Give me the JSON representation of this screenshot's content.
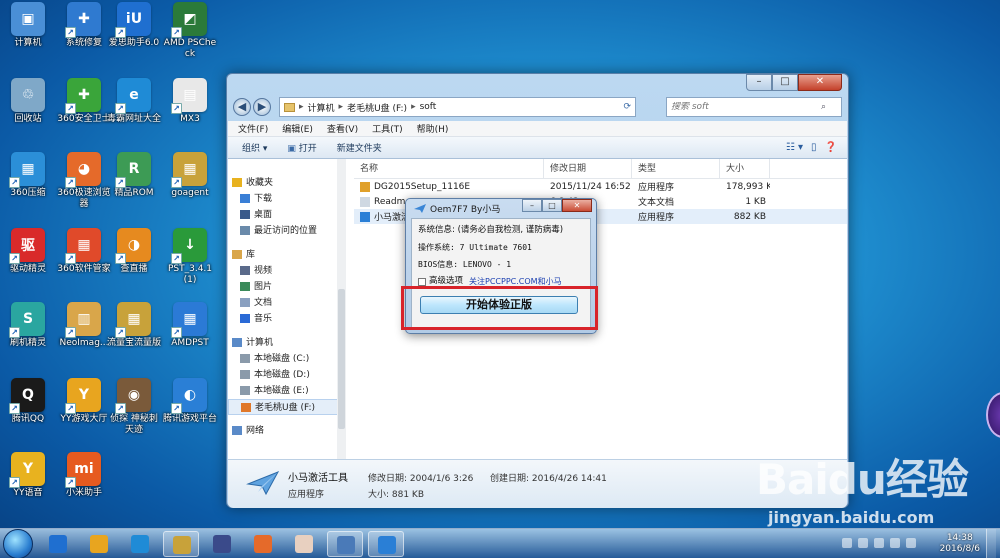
{
  "desktop": {
    "icons": [
      {
        "label": "计算机",
        "color": "#4a8fd6",
        "glyph": "▣"
      },
      {
        "label": "系统修复",
        "color": "#2f7ad0",
        "glyph": "✚"
      },
      {
        "label": "爱思助手6.0",
        "color": "#1f6fd0",
        "glyph": "iU"
      },
      {
        "label": "AMD PSCheck",
        "color": "#2b7a3a",
        "glyph": "◩"
      },
      {
        "label": "回收站",
        "color": "#7fa8c8",
        "glyph": "♲"
      },
      {
        "label": "360安全卫士",
        "color": "#3aa53a",
        "glyph": "✚"
      },
      {
        "label": "毒霸网址大全",
        "color": "#1f8bd6",
        "glyph": "e"
      },
      {
        "label": "MX3",
        "color": "#e8e8e8",
        "glyph": "▤"
      },
      {
        "label": "360压缩",
        "color": "#2b8fd8",
        "glyph": "▦"
      },
      {
        "label": "360极速浏览器",
        "color": "#e56a2a",
        "glyph": "◕"
      },
      {
        "label": "精品ROM",
        "color": "#3d9b55",
        "glyph": "R"
      },
      {
        "label": "goagent",
        "color": "#c8a23a",
        "glyph": "▦"
      },
      {
        "label": "驱动精灵",
        "color": "#d92a2a",
        "glyph": "驱"
      },
      {
        "label": "360软件管家",
        "color": "#e04a2a",
        "glyph": "▦"
      },
      {
        "label": "查直播",
        "color": "#e68a1f",
        "glyph": "◑"
      },
      {
        "label": "PST_3.4.1 (1)",
        "color": "#2a9a3a",
        "glyph": "↓"
      },
      {
        "label": "刷机精灵",
        "color": "#2aa6a0",
        "glyph": "S"
      },
      {
        "label": "NeoImag...",
        "color": "#d9a64a",
        "glyph": "▥"
      },
      {
        "label": "流量宝流量版",
        "color": "#c8a23a",
        "glyph": "▦"
      },
      {
        "label": "AMDPST",
        "color": "#2b7ad6",
        "glyph": "▦"
      },
      {
        "label": "腾讯QQ",
        "color": "#1a1a1a",
        "glyph": "Q"
      },
      {
        "label": "YY游戏大厅",
        "color": "#e8a51f",
        "glyph": "Y"
      },
      {
        "label": "侦探 神秘刺 天迹",
        "color": "#7a5a3a",
        "glyph": "◉"
      },
      {
        "label": "腾讯游戏平台",
        "color": "#2a7fd6",
        "glyph": "◐"
      },
      {
        "label": "YY语音",
        "color": "#e8b21f",
        "glyph": "Y"
      },
      {
        "label": "小米助手",
        "color": "#e65a1f",
        "glyph": "mi"
      }
    ]
  },
  "explorer": {
    "address": {
      "crumbs": [
        "计算机",
        "老毛桃U盘 (F:)",
        "soft"
      ]
    },
    "search": {
      "placeholder": "搜索 soft"
    },
    "menu": [
      "文件(F)",
      "编辑(E)",
      "查看(V)",
      "工具(T)",
      "帮助(H)"
    ],
    "toolbar": {
      "organize": "组织 ▾",
      "open": "打开",
      "new_folder": "新建文件夹"
    },
    "nav": [
      {
        "label": "收藏夹",
        "group": true,
        "color": "#e8b21f"
      },
      {
        "label": "下载",
        "group": false,
        "color": "#3a7fd6"
      },
      {
        "label": "桌面",
        "group": false,
        "color": "#3a5a8a"
      },
      {
        "label": "最近访问的位置",
        "group": false,
        "color": "#6a8aaa"
      },
      {
        "label": "库",
        "group": true,
        "color": "#d9a64a"
      },
      {
        "label": "视频",
        "group": false,
        "color": "#5a6a8a"
      },
      {
        "label": "图片",
        "group": false,
        "color": "#3a8a5a"
      },
      {
        "label": "文档",
        "group": false,
        "color": "#8aa0c0"
      },
      {
        "label": "音乐",
        "group": false,
        "color": "#2a6ad6"
      },
      {
        "label": "计算机",
        "group": true,
        "color": "#5a8ac8"
      },
      {
        "label": "本地磁盘 (C:)",
        "group": false,
        "color": "#8a9aaa"
      },
      {
        "label": "本地磁盘 (D:)",
        "group": false,
        "color": "#8a9aaa"
      },
      {
        "label": "本地磁盘 (E:)",
        "group": false,
        "color": "#8a9aaa"
      },
      {
        "label": "老毛桃U盘 (F:)",
        "group": false,
        "color": "#e0782a"
      },
      {
        "label": "网络",
        "group": true,
        "color": "#5a8ac8"
      }
    ],
    "columns": [
      "名称",
      "修改日期",
      "类型",
      "大小"
    ],
    "files": [
      {
        "name": "DG2015Setup_1116E",
        "date": "2015/11/24 16:52",
        "type": "应用程序",
        "size": "178,993 KB",
        "color": "#e0a02a"
      },
      {
        "name": "Readme",
        "date": "6 8:42",
        "type": "文本文档",
        "size": "1 KB",
        "color": "#cfd8e2"
      },
      {
        "name": "小马激活",
        "date": "6 3:26",
        "type": "应用程序",
        "size": "882 KB",
        "color": "#2a7fd6"
      }
    ],
    "details": {
      "name": "小马激活工具",
      "type": "应用程序",
      "modified_label": "修改日期: 2004/1/6 3:26",
      "created_label": "创建日期: 2016/4/26 14:41",
      "size_label": "大小: 881 KB"
    }
  },
  "dialog": {
    "title": "Oem7F7 By小马",
    "sysinfo": "系统信息: (请务必自我检测, 谨防病毒)",
    "os": "操作系统: 7 Ultimate 7601",
    "bios": "BIOS信息: LENOVO - 1",
    "advanced": "高级选项",
    "about_link": "关注PCCPPC.COM和小马",
    "start_button": "开始体验正版"
  },
  "watermark": {
    "brand": "Baidu经验",
    "url": "jingyan.baidu.com"
  },
  "taskbar": {
    "time": "14:38",
    "date": "2016/8/6",
    "items": [
      {
        "color": "#1f6fd0",
        "open": false
      },
      {
        "color": "#e8a51f",
        "open": false
      },
      {
        "color": "#1f8bd6",
        "open": false
      },
      {
        "color": "#c8a23a",
        "open": true
      },
      {
        "color": "#3a4a8a",
        "open": false
      },
      {
        "color": "#e56a2a",
        "open": false
      },
      {
        "color": "#e8d0c0",
        "open": false
      },
      {
        "color": "#4a7ab8",
        "open": true
      },
      {
        "color": "#2a7fd6",
        "open": true
      }
    ]
  }
}
